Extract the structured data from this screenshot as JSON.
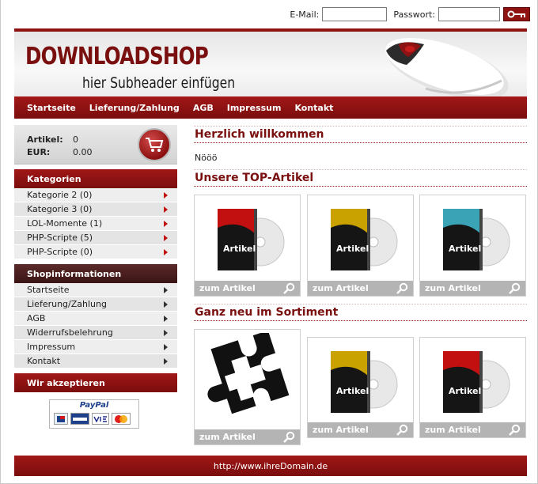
{
  "login": {
    "email_label": "E-Mail:",
    "password_label": "Passwort:",
    "email_value": "",
    "password_value": ""
  },
  "header": {
    "logo": "DOWNLOADSHOP",
    "subheader": "hier Subheader einfügen"
  },
  "nav": {
    "items": [
      "Startseite",
      "Lieferung/Zahlung",
      "AGB",
      "Impressum",
      "Kontakt"
    ]
  },
  "cart": {
    "articles_label": "Artikel:",
    "articles_value": "0",
    "eur_label": "EUR:",
    "eur_value": "0.00"
  },
  "categories": {
    "title": "Kategorien",
    "items": [
      "Kategorie 2 (0)",
      "Kategorie 3 (0)",
      "LOL-Momente (1)",
      "PHP-Scripte (5)",
      "PHP-Scripte (0)"
    ]
  },
  "shopinfo": {
    "title": "Shopinformationen",
    "items": [
      "Startseite",
      "Lieferung/Zahlung",
      "AGB",
      "Widerrufsbelehrung",
      "Impressum",
      "Kontakt"
    ]
  },
  "payment": {
    "title": "Wir akzeptieren",
    "paypal": "PayPal"
  },
  "main": {
    "welcome_title": "Herzlich willkommen",
    "welcome_text": "Nööö",
    "top_title": "Unsere TOP-Artikel",
    "new_title": "Ganz neu im Sortiment",
    "link_label": "zum Artikel",
    "box_label": "Artikel"
  },
  "colors": {
    "accent": "#8e1212",
    "dark": "#3b1414",
    "red": "#c20f0f",
    "yellow": "#c9a200",
    "cyan": "#3aa3b5"
  },
  "products_top": [
    "red",
    "yellow",
    "cyan"
  ],
  "products_new": [
    "puzzle",
    "yellow",
    "red"
  ],
  "footer": {
    "url": "http://www.ihreDomain.de"
  }
}
